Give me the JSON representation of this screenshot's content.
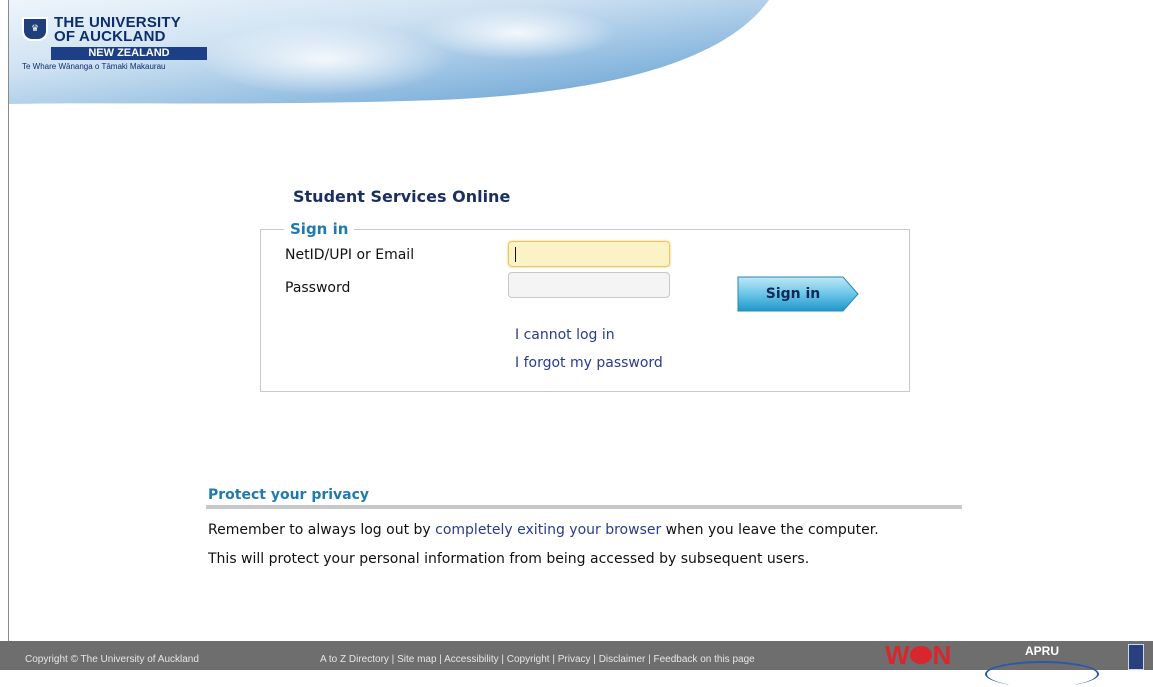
{
  "header": {
    "logo": {
      "line1": "THE UNIVERSITY",
      "line2": "OF AUCKLAND",
      "country": "NEW ZEALAND",
      "maori": "Te Whare Wānanga o Tāmaki Makaurau"
    }
  },
  "main": {
    "title": "Student Services Online",
    "signin": {
      "legend": "Sign in",
      "username_label": "NetID/UPI or Email",
      "username_value": "",
      "password_label": "Password",
      "password_value": "",
      "button_label": "Sign in",
      "cannot_login_link": "I cannot log in",
      "forgot_password_link": "I forgot my password"
    },
    "privacy": {
      "title": "Protect your privacy",
      "line1_before": "Remember to always log out by ",
      "line1_link": "completely exiting your browser",
      "line1_after": " when you leave the computer.",
      "line2": "This will protect your personal information from being accessed by subsequent users."
    }
  },
  "footer": {
    "copyright": "Copyright © The University of Auckland",
    "links": [
      "A to Z Directory",
      "Site map",
      "Accessibility",
      "Copyright",
      "Privacy",
      "Disclaimer",
      "Feedback on this page"
    ],
    "separator": " | ",
    "won_logo": "WON",
    "apru_logo": "APRU"
  },
  "colors": {
    "title": "#1c2f61",
    "accent": "#1f7ab0",
    "link": "#2a3b8f",
    "footer_bg": "#6e6e6e",
    "button": "#3aa9d4"
  }
}
